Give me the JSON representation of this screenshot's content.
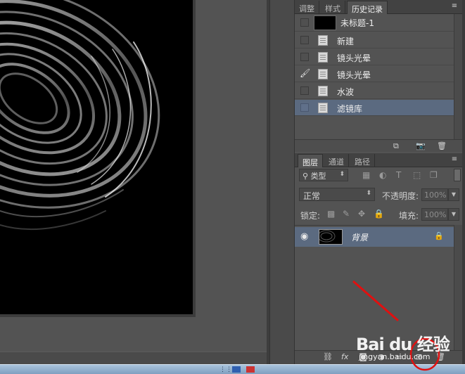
{
  "history_panel": {
    "tabs": [
      "调整",
      "样式",
      "历史记录"
    ],
    "active_tab": "历史记录",
    "menu_icon": "panel-menu-icon",
    "snapshot_label": "未标题-1",
    "states": [
      {
        "label": "新建",
        "selected": false,
        "brush_source": false
      },
      {
        "label": "镜头光晕",
        "selected": false,
        "brush_source": false
      },
      {
        "label": "镜头光晕",
        "selected": false,
        "brush_source": true
      },
      {
        "label": "水波",
        "selected": false,
        "brush_source": false
      },
      {
        "label": "滤镜库",
        "selected": true,
        "brush_source": false
      }
    ],
    "footer_icons": [
      "new-document-from-state-icon",
      "snapshot-camera-icon",
      "trash-icon"
    ]
  },
  "layers_panel": {
    "tabs": [
      "图层",
      "通道",
      "路径"
    ],
    "active_tab": "图层",
    "filter_label": "类型",
    "filter_icons": [
      "image-filter-icon",
      "adjustment-filter-icon",
      "type-filter-icon",
      "shape-filter-icon",
      "smart-object-filter-icon"
    ],
    "blend_mode": "正常",
    "opacity_label": "不透明度:",
    "opacity_value": "100%",
    "lock_label": "锁定:",
    "fill_label": "填充:",
    "fill_value": "100%",
    "layers": [
      {
        "name": "背景",
        "visible": true,
        "locked": true,
        "selected": true
      }
    ],
    "footer_icons": [
      "link-icon",
      "fx-icon",
      "mask-icon",
      "adjustment-icon",
      "folder-icon",
      "new-layer-icon",
      "trash-icon"
    ]
  },
  "watermark": {
    "brand": "Bai du 经验",
    "url": "jingyan.baidu.com"
  },
  "colors": {
    "panel_bg": "#535353",
    "selection": "#5b6a80",
    "canvas_doc": "#000000",
    "annotation_red": "#e01010"
  }
}
